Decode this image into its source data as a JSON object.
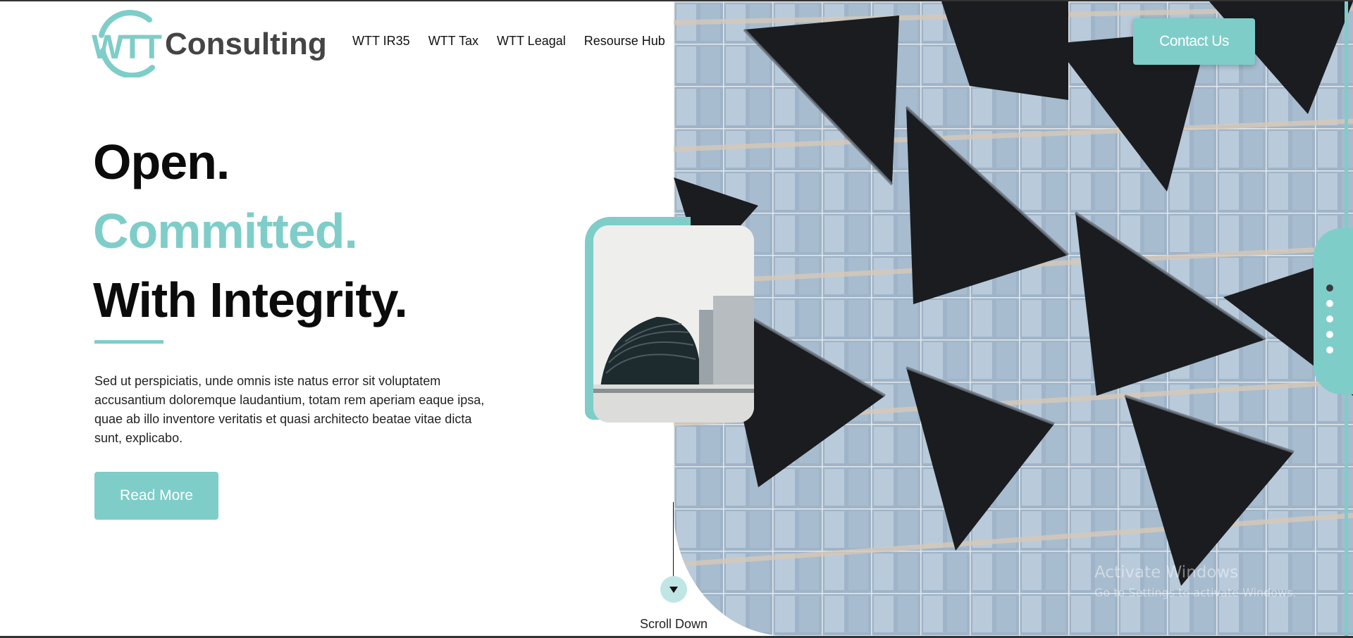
{
  "brand": {
    "logo_mark_text": "WTT",
    "name": "Consulting",
    "accent_color": "#7ecdc9",
    "logo_text_color": "#444444"
  },
  "nav": {
    "items": [
      {
        "label": "WTT IR35"
      },
      {
        "label": "WTT Tax"
      },
      {
        "label": "WTT Leagal"
      },
      {
        "label": "Resourse Hub"
      }
    ]
  },
  "header": {
    "contact_label": "Contact Us"
  },
  "hero": {
    "line1": "Open.",
    "line2": "Committed.",
    "line3": "With Integrity.",
    "body": "Sed ut perspiciatis, unde omnis iste natus error sit voluptatem accusantium doloremque laudantium, totam rem aperiam eaque ipsa, quae ab illo inventore veritatis et quasi architecto beatae vitae dicta sunt, explicabo.",
    "cta_label": "Read More"
  },
  "scroll": {
    "label": "Scroll Down",
    "icon": "arrow-down-icon"
  },
  "slider": {
    "dot_count": 5,
    "active_index": 0
  },
  "watermark": {
    "title": "Activate Windows",
    "subtitle": "Go to Settings to activate Windows."
  }
}
